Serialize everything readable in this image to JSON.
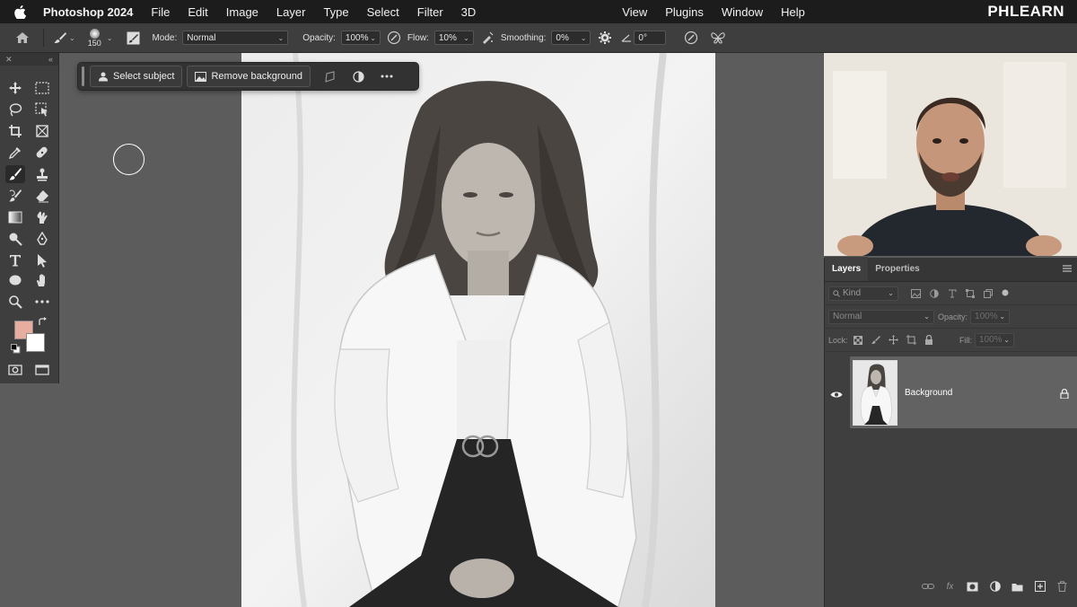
{
  "menubar": {
    "app_name": "Photoshop 2024",
    "items": [
      "File",
      "Edit",
      "Image",
      "Layer",
      "Type",
      "Select",
      "Filter",
      "3D",
      "View",
      "Plugins",
      "Window",
      "Help"
    ],
    "brand": "PHLEARN"
  },
  "options": {
    "brush_size": "150",
    "mode_label": "Mode:",
    "mode_value": "Normal",
    "opacity_label": "Opacity:",
    "opacity_value": "100%",
    "flow_label": "Flow:",
    "flow_value": "10%",
    "smoothing_label": "Smoothing:",
    "smoothing_value": "0%",
    "angle_value": "0°"
  },
  "taskbar": {
    "select_subject": "Select subject",
    "remove_background": "Remove background"
  },
  "toolbar": {
    "foreground_color": "#e7aea0",
    "background_color": "#ffffff"
  },
  "layers_panel": {
    "tabs": [
      "Layers",
      "Properties"
    ],
    "filter_placeholder": "Kind",
    "blend_mode": "Normal",
    "opacity_label": "Opacity:",
    "opacity_value": "100%",
    "lock_label": "Lock:",
    "fill_label": "Fill:",
    "fill_value": "100%",
    "layers": [
      {
        "name": "Background",
        "visible": true,
        "locked": true
      }
    ]
  }
}
